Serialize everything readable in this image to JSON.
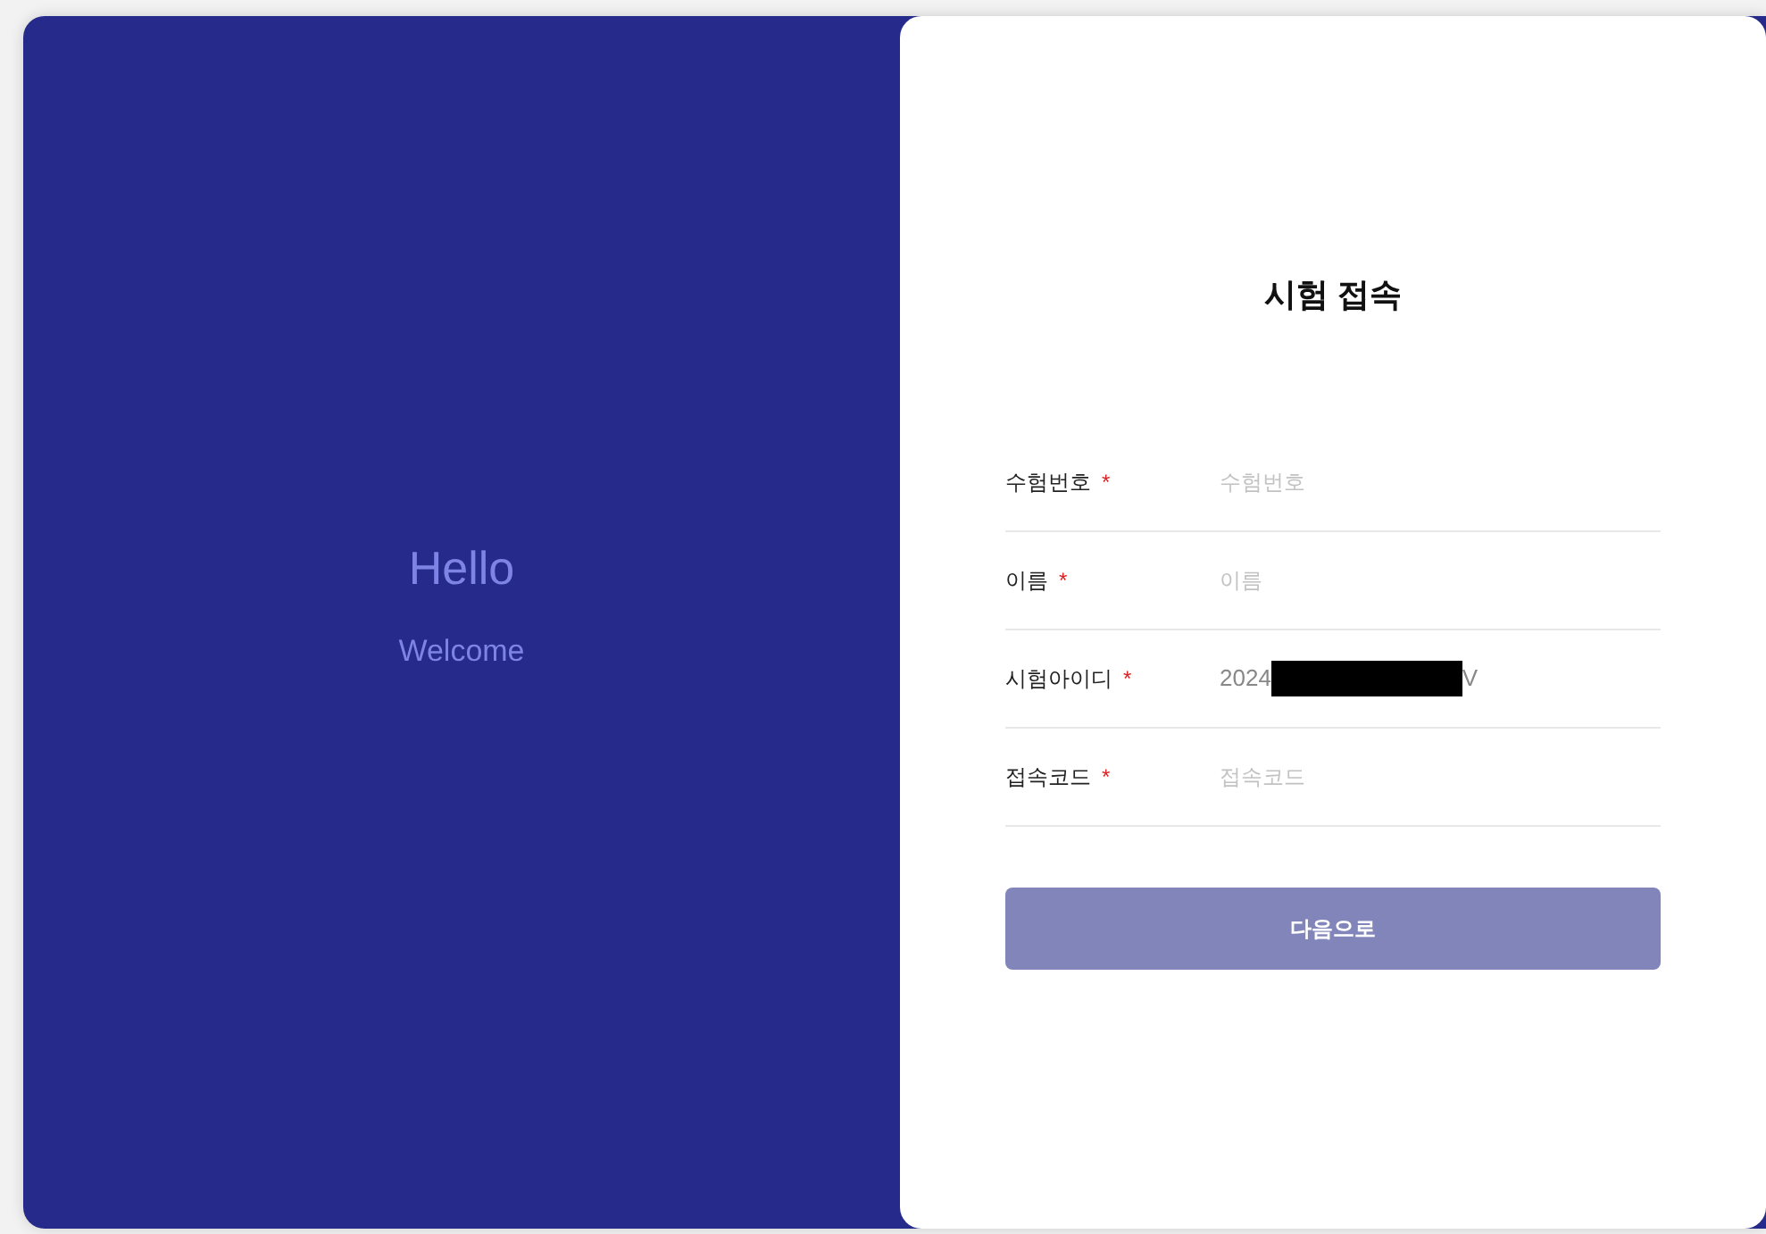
{
  "welcome": {
    "title": "Hello",
    "subtitle": "Welcome"
  },
  "form": {
    "title": "시험 접속",
    "fields": [
      {
        "label": "수험번호",
        "required": "*",
        "placeholder": "수험번호"
      },
      {
        "label": "이름",
        "required": "*",
        "placeholder": "이름"
      },
      {
        "label": "시험아이디",
        "required": "*",
        "value": "2024",
        "redacted": true,
        "value_tail": "V"
      },
      {
        "label": "접속코드",
        "required": "*",
        "placeholder": "접속코드"
      }
    ],
    "submit": {
      "label": "다음으로",
      "disabled": true
    }
  }
}
